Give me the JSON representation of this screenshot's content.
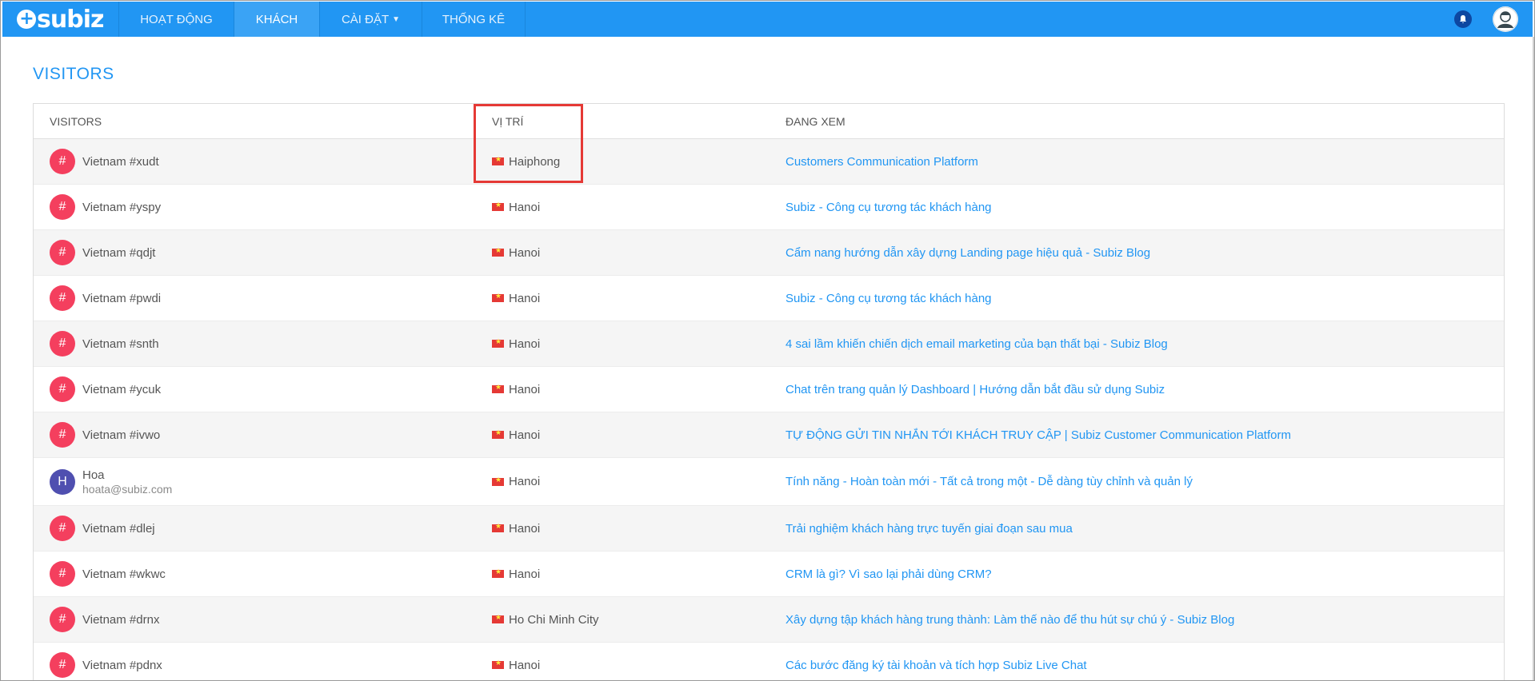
{
  "brand": {
    "logo_text": "subiz"
  },
  "nav": [
    {
      "label": "HOẠT ĐỘNG",
      "active": false
    },
    {
      "label": "KHÁCH",
      "active": true
    },
    {
      "label": "CÀI ĐẶT",
      "active": false,
      "has_caret": true
    },
    {
      "label": "THỐNG KÊ",
      "active": false
    }
  ],
  "topbar_icons": {
    "notification": "bell-icon",
    "profile": "user-avatar-icon"
  },
  "page": {
    "title": "VISITORS"
  },
  "table": {
    "headers": [
      "VISITORS",
      "VỊ TRÍ",
      "ĐANG XEM"
    ],
    "rows": [
      {
        "badge": "#",
        "name": "Vietnam #xudt",
        "email": "",
        "location": "Haiphong",
        "viewing": "Customers Communication Platform"
      },
      {
        "badge": "#",
        "name": "Vietnam #yspy",
        "email": "",
        "location": "Hanoi",
        "viewing": "Subiz - Công cụ tương tác khách hàng"
      },
      {
        "badge": "#",
        "name": "Vietnam #qdjt",
        "email": "",
        "location": "Hanoi",
        "viewing": "Cẩm nang hướng dẫn xây dựng Landing page hiệu quả - Subiz Blog"
      },
      {
        "badge": "#",
        "name": "Vietnam #pwdi",
        "email": "",
        "location": "Hanoi",
        "viewing": "Subiz - Công cụ tương tác khách hàng"
      },
      {
        "badge": "#",
        "name": "Vietnam #snth",
        "email": "",
        "location": "Hanoi",
        "viewing": "4 sai lầm khiến chiến dịch email marketing của bạn thất bại - Subiz Blog"
      },
      {
        "badge": "#",
        "name": "Vietnam #ycuk",
        "email": "",
        "location": "Hanoi",
        "viewing": "Chat trên trang quản lý Dashboard | Hướng dẫn bắt đầu sử dụng Subiz"
      },
      {
        "badge": "#",
        "name": "Vietnam #ivwo",
        "email": "",
        "location": "Hanoi",
        "viewing": "TỰ ĐỘNG GỬI TIN NHẮN TỚI KHÁCH TRUY CẬP | Subiz Customer Communication Platform"
      },
      {
        "badge": "H",
        "name": "Hoa",
        "email": "hoata@subiz.com",
        "location": "Hanoi",
        "viewing": "Tính năng - Hoàn toàn mới - Tất cả trong một - Dễ dàng tùy chỉnh và quản lý"
      },
      {
        "badge": "#",
        "name": "Vietnam #dlej",
        "email": "",
        "location": "Hanoi",
        "viewing": "Trải nghiệm khách hàng trực tuyến giai đoạn sau mua"
      },
      {
        "badge": "#",
        "name": "Vietnam #wkwc",
        "email": "",
        "location": "Hanoi",
        "viewing": "CRM là gì? Vì sao lại phải dùng CRM?"
      },
      {
        "badge": "#",
        "name": "Vietnam #drnx",
        "email": "",
        "location": "Ho Chi Minh City",
        "viewing": "Xây dựng tập khách hàng trung thành: Làm thế nào để thu hút sự chú ý - Subiz Blog"
      },
      {
        "badge": "#",
        "name": "Vietnam #pdnx",
        "email": "",
        "location": "Hanoi",
        "viewing": "Các bước đăng ký tài khoản và tích hợp Subiz Live Chat"
      }
    ]
  },
  "colors": {
    "brand": "#2196f3",
    "badge": "#f43f5e",
    "user_badge": "#4f4fb0",
    "highlight": "#e53935"
  }
}
